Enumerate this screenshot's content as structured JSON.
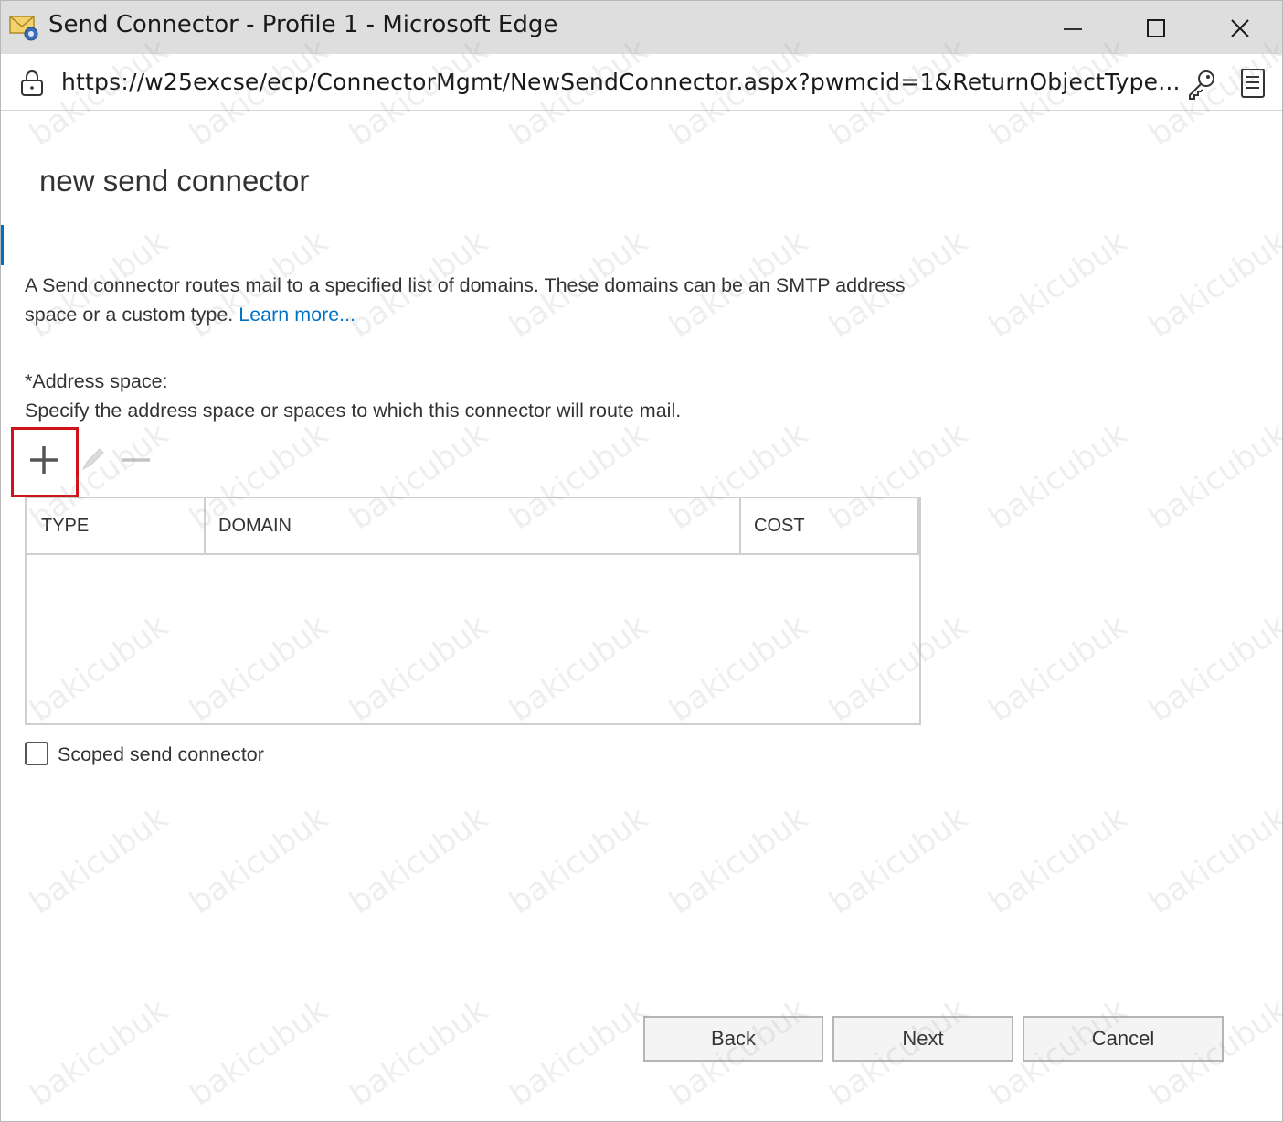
{
  "window": {
    "title": "Send Connector - Profile 1 - Microsoft Edge"
  },
  "addressbar": {
    "url": "https://w25excse/ecp/ConnectorMgmt/NewSendConnector.aspx?pwmcid=1&ReturnObjectType..."
  },
  "page": {
    "title": "new send connector",
    "description": "A Send connector routes mail to a specified list of domains. These domains can be an SMTP address space or a custom type.",
    "learn_more": "Learn more..."
  },
  "address_space": {
    "label": "*Address space:",
    "help": "Specify the address space or spaces to which this connector will route mail.",
    "toolbar": {
      "add_icon": "plus-icon",
      "edit_icon": "pencil-icon",
      "remove_icon": "minus-icon"
    },
    "columns": [
      "TYPE",
      "DOMAIN",
      "COST"
    ],
    "rows": []
  },
  "scoped": {
    "label": "Scoped send connector",
    "checked": false
  },
  "footer": {
    "back": "Back",
    "next": "Next",
    "cancel": "Cancel"
  },
  "watermark": "bakicubuk",
  "colors": {
    "link": "#0072c6",
    "highlight": "#d0121b",
    "titlebar": "#dedede"
  }
}
